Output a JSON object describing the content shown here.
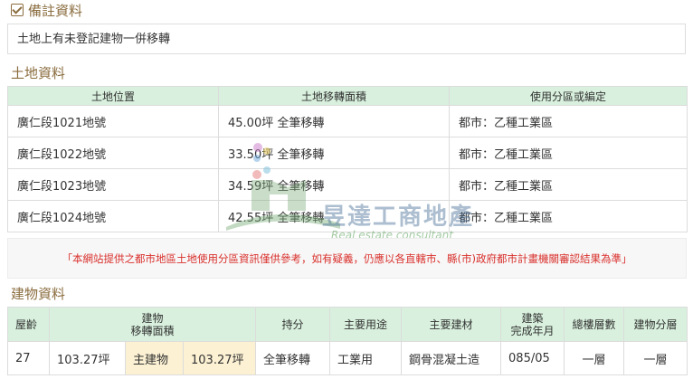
{
  "remarks": {
    "title": "備註資料",
    "text": "土地上有未登記建物一併移轉"
  },
  "land": {
    "title": "土地資料",
    "headers": [
      "土地位置",
      "土地移轉面積",
      "使用分區或編定"
    ],
    "rows": [
      [
        "廣仁段1021地號",
        "45.00坪 全筆移轉",
        "都市：乙種工業區"
      ],
      [
        "廣仁段1022地號",
        "33.50坪 全筆移轉",
        "都市：乙種工業區"
      ],
      [
        "廣仁段1023地號",
        "34.59坪 全筆移轉",
        "都市：乙種工業區"
      ],
      [
        "廣仁段1024地號",
        "42.55坪 全筆移轉",
        "都市：乙種工業區"
      ]
    ]
  },
  "notice": "「本網站提供之都市地區土地使用分區資訊僅供參考，如有疑義，仍應以各直轄市、縣(市)政府都市計畫機關審認結果為準」",
  "building": {
    "title": "建物資料",
    "headers": {
      "age": "屋齡",
      "area_line1": "建物",
      "area_line2": "移轉面積",
      "share": "持分",
      "use": "主要用途",
      "material": "主要建材",
      "built_line1": "建築",
      "built_line2": "完成年月",
      "floors": "總樓層數",
      "floor": "建物分層"
    },
    "row": {
      "age": "27",
      "total_area": "103.27坪",
      "main_label": "主建物",
      "main_area": "103.27坪",
      "share": "全筆移轉",
      "use": "工業用",
      "material": "鋼骨混凝土造",
      "built": "085/05",
      "floors": "一層",
      "floor": "一層"
    }
  },
  "watermark": {
    "name": "昱達工商地產",
    "sub": "Real estate consultant"
  },
  "colors": {
    "section_title": "#8b6d3f",
    "table_header_bg": "#d8f0dd",
    "highlight_cell": "#fcf1d3",
    "notice_text": "#d9302c"
  }
}
